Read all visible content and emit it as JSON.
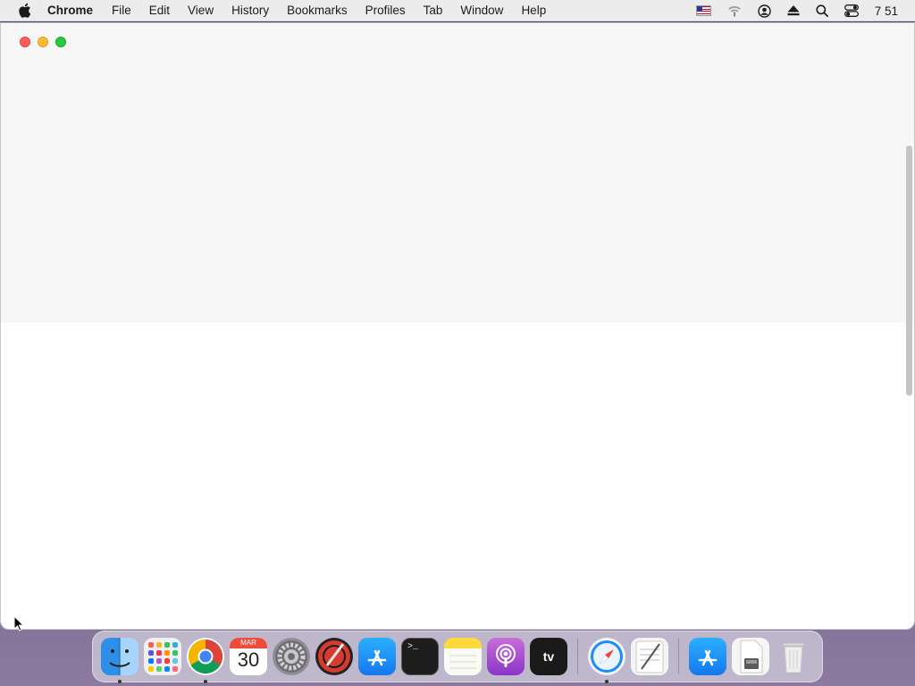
{
  "menubar": {
    "app_name": "Chrome",
    "items": [
      "File",
      "Edit",
      "View",
      "History",
      "Bookmarks",
      "Profiles",
      "Tab",
      "Window",
      "Help"
    ],
    "clock": "7 51"
  },
  "dock": {
    "items": [
      {
        "name": "Finder",
        "running": true
      },
      {
        "name": "Launchpad",
        "running": false
      },
      {
        "name": "Google Chrome",
        "running": true
      },
      {
        "name": "Calendar",
        "running": false,
        "month": "MAR",
        "day": "30"
      },
      {
        "name": "System Preferences",
        "running": false
      },
      {
        "name": "Instruments",
        "running": false
      },
      {
        "name": "App Store",
        "running": false
      },
      {
        "name": "Terminal",
        "running": false,
        "prompt": ">_"
      },
      {
        "name": "Notes",
        "running": false
      },
      {
        "name": "Podcasts",
        "running": false
      },
      {
        "name": "TV",
        "running": false,
        "label": "tv"
      },
      {
        "name": "Safari",
        "running": true
      },
      {
        "name": "TextEdit",
        "running": false
      },
      {
        "name": "App Store Downloads",
        "running": false
      },
      {
        "name": "Disk Image",
        "running": false
      },
      {
        "name": "Trash",
        "running": false
      }
    ]
  },
  "colors": {
    "close": "#fe5f57",
    "minimize": "#febc2e",
    "maximize": "#28c840"
  }
}
